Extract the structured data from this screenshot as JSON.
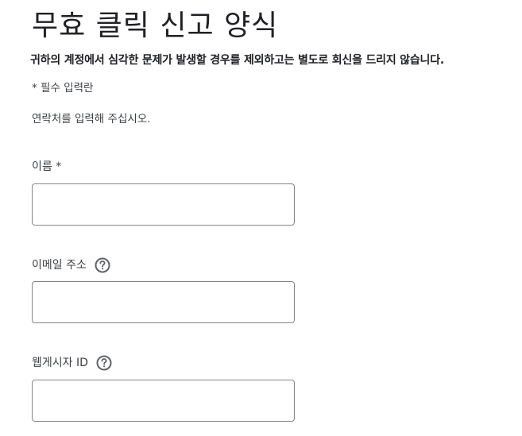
{
  "form": {
    "title": "무효 클릭 신고 양식",
    "notice": "귀하의 계정에서 심각한 문제가 발생할 경우를 제외하고는 별도로 회신을 드리지 않습니다.",
    "required_note": "* 필수 입력란",
    "contact_note": "연락처를 입력해 주십시오.",
    "fields": [
      {
        "label": "이름 *",
        "value": "",
        "has_help": false
      },
      {
        "label": "이메일 주소",
        "value": "",
        "has_help": true,
        "help_icon": "help-circle-icon"
      },
      {
        "label": "웹게시자 ID",
        "value": "",
        "has_help": true,
        "help_icon": "help-circle-icon"
      }
    ]
  },
  "colors": {
    "text": "#202124",
    "label": "#3c4043",
    "input_border": "#80868b",
    "icon": "#5f6368"
  }
}
